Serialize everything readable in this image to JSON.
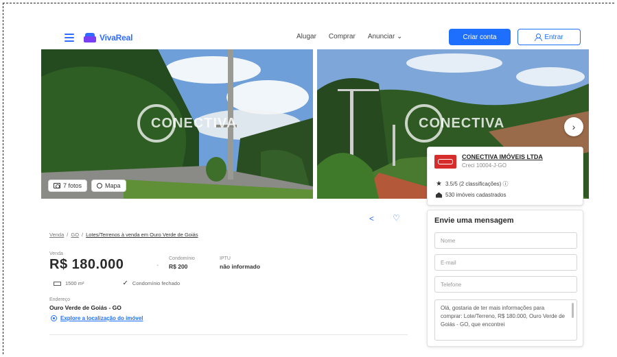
{
  "header": {
    "brand": "VivaReal",
    "nav": [
      "Alugar",
      "Comprar",
      "Anunciar ⌄"
    ],
    "create_account": "Criar conta",
    "login": "Entrar",
    "colors": {
      "primary": "#1f6fff",
      "brand_secondary": "#7a3ff2"
    }
  },
  "gallery": {
    "watermark": "CONECTIVA",
    "photos_button": "7 fotos",
    "map_button": "Mapa",
    "next_icon": "chevron-right-icon"
  },
  "agency": {
    "name": "CONECTIVA IMÓVEIS LTDA",
    "creci": "Creci 10004-J-GO",
    "rating": "3.5/5 (2 classificações) ⓘ",
    "listings": "530 imóveis cadastrados"
  },
  "listing": {
    "breadcrumb": [
      "Venda",
      "GO",
      "Lotes/Terrenos à venda em Ouro Verde de Goiás"
    ],
    "price_label": "Venda",
    "price": "R$ 180.000",
    "condo_label": "Condomínio",
    "condo_value": "R$ 200",
    "iptu_label": "IPTU",
    "iptu_value": "não informado",
    "area": "1500 m²",
    "gated": "Condomínio fechado",
    "address_label": "Endereço",
    "address": "Ouro Verde de Goiás - GO",
    "explore": "Explore a localização do imóvel"
  },
  "message": {
    "title": "Envie uma mensagem",
    "name_placeholder": "Nome",
    "email_placeholder": "E-mail",
    "phone_placeholder": "Telefone",
    "body": "Olá, gostaria de ter mais informações para comprar: Lote/Terreno, R$ 180.000, Ouro Verde de Goiás - GO, que encontrei"
  }
}
